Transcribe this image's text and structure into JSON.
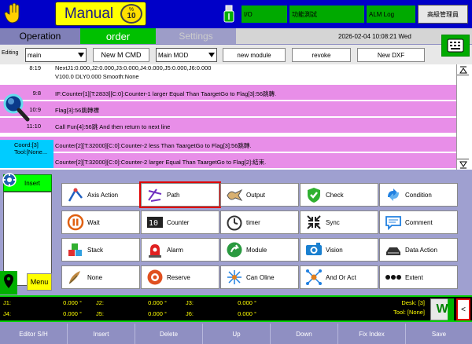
{
  "header": {
    "mode": "Manual",
    "speed_unit": "%",
    "speed_value": "10",
    "io_label": "I/O",
    "test_label": "功能測試",
    "alm_log_label": "ALM Log",
    "user_label": "高級管理員"
  },
  "tabs": {
    "operation": "Operation",
    "order": "order",
    "settings": "Settings"
  },
  "datetime": "2026-02-04  10:08:21 Wed",
  "toolbar": {
    "editing_label": "Editing",
    "file_value": "main",
    "new_cmd": "New M CMD",
    "module_value": "Main MOD",
    "new_module": "new module",
    "revoke": "revoke",
    "new_dxf": "New DXF"
  },
  "program": {
    "rows": [
      {
        "line": "8:19",
        "text": "NextJ1:0.000,J2:0.000,J3:0.000,J4:0.000,J5:0.000,J6:0.000"
      },
      {
        "line": "",
        "text": "V100.0 DLY0.000 Smooth:None"
      },
      {
        "line": "9:8",
        "text": "IF:Counter[1][T:2833][C:0]:Counter-1 larger Equal Than TaargetGo to Flag[3]:56跳轉."
      },
      {
        "line": "10:9",
        "text": "Flag[3]:56跳轉標"
      },
      {
        "line": "11:10",
        "text": "Call Fun[4]:56跳 And then return to next line"
      },
      {
        "line": "",
        "text": "Counter[2][T:32000][C:0]:Counter-2 less Than TaargetGo to Flag[3]:56跳轉."
      },
      {
        "line": "",
        "text": "Counter[2][T:32000][C:0]:Counter-2 larger Equal Than TaargetGo to Flag[2]:結束."
      }
    ]
  },
  "coord": {
    "coord_text": "Coord:[3]",
    "tool_text": "Tool:[None..."
  },
  "left_panel": {
    "insert_label": "Insert",
    "menu_label": "Menu"
  },
  "commands": [
    {
      "label": "Axis Action",
      "icon": "axis-action-icon"
    },
    {
      "label": "Path",
      "icon": "path-icon"
    },
    {
      "label": "Output",
      "icon": "output-icon"
    },
    {
      "label": "Check",
      "icon": "check-icon"
    },
    {
      "label": "Condition",
      "icon": "condition-icon"
    },
    {
      "label": "Wait",
      "icon": "wait-icon"
    },
    {
      "label": "Counter",
      "icon": "counter-icon"
    },
    {
      "label": "timer",
      "icon": "timer-icon"
    },
    {
      "label": "Sync",
      "icon": "sync-icon"
    },
    {
      "label": "Comment",
      "icon": "comment-icon"
    },
    {
      "label": "Stack",
      "icon": "stack-icon"
    },
    {
      "label": "Alarm",
      "icon": "alarm-icon"
    },
    {
      "label": "Module",
      "icon": "module-icon"
    },
    {
      "label": "Vision",
      "icon": "vision-icon"
    },
    {
      "label": "Data Action",
      "icon": "data-action-icon"
    },
    {
      "label": "None",
      "icon": "none-icon"
    },
    {
      "label": "Reserve",
      "icon": "reserve-icon"
    },
    {
      "label": "Can Oline",
      "icon": "can-oline-icon"
    },
    {
      "label": "And Or Act",
      "icon": "and-or-icon"
    },
    {
      "label": "Extent",
      "icon": "extent-icon"
    }
  ],
  "selected_command": "Path",
  "axes": {
    "j1_label": "J1:",
    "j1_value": "0.000 °",
    "j2_label": "J2:",
    "j2_value": "0.000 °",
    "j3_label": "J3:",
    "j3_value": "0.000 °",
    "j4_label": "J4:",
    "j4_value": "0.000 °",
    "j5_label": "J5:",
    "j5_value": "0.000 °",
    "j6_label": "J6:",
    "j6_value": "0.000 °",
    "desk": "Desk: [3]",
    "tool": "Tool: [None]",
    "w_label": "W",
    "back_label": "<"
  },
  "footer": {
    "editor": "Editor S/H",
    "insert": "Insert",
    "delete": "Delete",
    "up": "Up",
    "down": "Down",
    "fix_index": "Fix Index",
    "save": "Save"
  },
  "colors": {
    "top_bar": "#0000c8",
    "accent_green": "#00c000",
    "program_pink": "#e88ee8",
    "selection_red": "#e00000",
    "axis_text": "#ffff00"
  }
}
